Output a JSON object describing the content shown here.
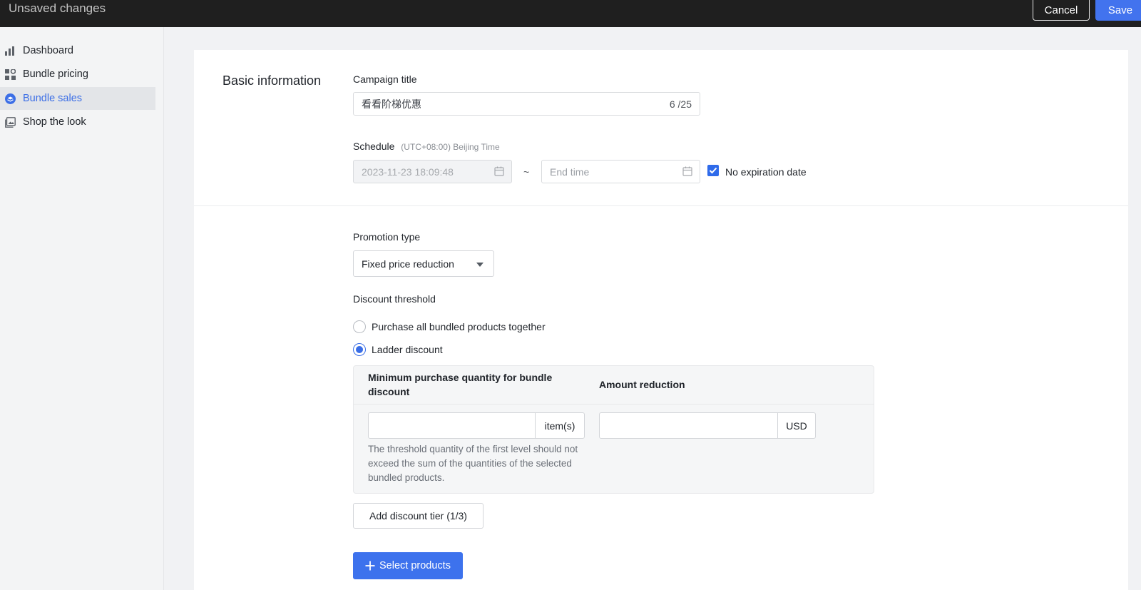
{
  "topbar": {
    "title": "Unsaved changes",
    "cancel_label": "Cancel",
    "save_label": "Save"
  },
  "sidebar": {
    "items": [
      {
        "label": "Dashboard",
        "icon": "bar-chart-icon",
        "active": false
      },
      {
        "label": "Bundle pricing",
        "icon": "grid-icon",
        "active": false
      },
      {
        "label": "Bundle sales",
        "icon": "layers-icon",
        "active": true
      },
      {
        "label": "Shop the look",
        "icon": "image-gallery-icon",
        "active": false
      }
    ]
  },
  "basic_info": {
    "section_title": "Basic information",
    "campaign_title_label": "Campaign title",
    "campaign_title_value": "看看阶梯优惠",
    "campaign_title_counter": "6 /25",
    "schedule_label": "Schedule",
    "schedule_timezone": "(UTC+08:00) Beijing Time",
    "start_time_value": "2023-11-23 18:09:48",
    "end_time_placeholder": "End time",
    "range_separator": "~",
    "no_expiration_label": "No expiration date",
    "no_expiration_checked": true
  },
  "promotion": {
    "type_label": "Promotion type",
    "type_value": "Fixed price reduction",
    "threshold_label": "Discount threshold",
    "radio_all_label": "Purchase all bundled products together",
    "radio_ladder_label": "Ladder discount",
    "selected_radio": "ladder",
    "tier_table": {
      "col_min_qty_header": "Minimum purchase quantity for bundle discount",
      "col_amount_header": "Amount reduction",
      "qty_unit": "item(s)",
      "amount_unit": "USD",
      "qty_value": "",
      "amount_value": "",
      "help_text": "The threshold quantity of the first level should not exceed the sum of the quantities of the selected bundled products."
    },
    "add_tier_label": "Add discount tier (1/3)",
    "select_products_label": "Select products"
  },
  "colors": {
    "accent": "#3d72ed",
    "topbar_bg": "#1f1f1f",
    "sidebar_active_text": "#3b6ee6"
  }
}
